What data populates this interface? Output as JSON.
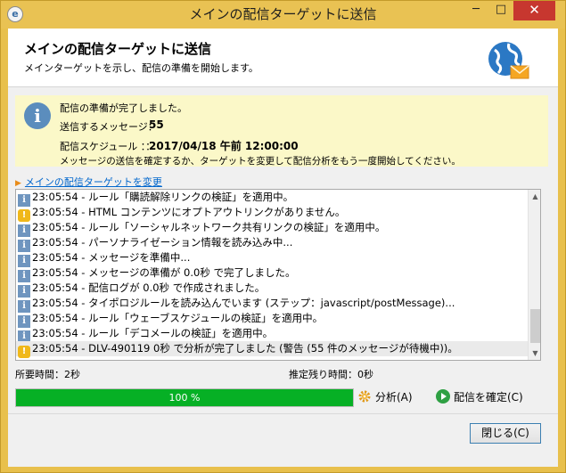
{
  "window": {
    "title": "メインの配信ターゲットに送信",
    "close_glyph": "✕",
    "minimize_glyph": "─",
    "maximize_glyph": "□"
  },
  "header": {
    "title": "メインの配信ターゲットに送信",
    "subtitle": "メインターゲットを示し、配信の準備を開始します。"
  },
  "info": {
    "status": "配信の準備が完了しました。",
    "messages_label": "送信するメッセージ：",
    "messages_value": "55",
    "schedule_label": "配信スケジュール ：：",
    "schedule_value": "2017/04/18 午前 12:00:00",
    "note": "メッセージの送信を確定するか、ターゲットを変更して配信分析をもう一度開始してください。"
  },
  "change_target_link": "メインの配信ターゲットを変更",
  "log": [
    {
      "type": "info",
      "text": "23:05:54 - ルール「購読解除リンクの検証」を適用中。"
    },
    {
      "type": "warn",
      "text": "23:05:54 - HTML コンテンツにオプトアウトリンクがありません。"
    },
    {
      "type": "info",
      "text": "23:05:54 - ルール「ソーシャルネットワーク共有リンクの検証」を適用中。"
    },
    {
      "type": "info",
      "text": "23:05:54 - パーソナライゼーション情報を読み込み中..."
    },
    {
      "type": "info",
      "text": "23:05:54 - メッセージを準備中..."
    },
    {
      "type": "info",
      "text": "23:05:54 - メッセージの準備が 0.0秒 で完了しました。"
    },
    {
      "type": "info",
      "text": "23:05:54 - 配信ログが  0.0秒 で作成されました。"
    },
    {
      "type": "info",
      "text": "23:05:54 - タイポロジルールを読み込んでいます (ステップ：javascript/postMessage)..."
    },
    {
      "type": "info",
      "text": "23:05:54 - ルール「ウェーブスケジュールの検証」を適用中。"
    },
    {
      "type": "info",
      "text": "23:05:54 - ルール「デコメールの検証」を適用中。"
    },
    {
      "type": "warn",
      "text": "23:05:54 - DLV-490119 0秒 で分析が完了しました (警告 (55 件のメッセージが待機中))。"
    }
  ],
  "selected_log_index": 10,
  "elapsed": "所要時間：2秒",
  "remaining": "推定残り時間：0秒",
  "progress": {
    "percent": 100,
    "label": "100 %",
    "color": "#06b025"
  },
  "buttons": {
    "analyze": "分析(A)",
    "confirm": "配信を確定(C)",
    "close": "閉じる(C)"
  },
  "colors": {
    "frame": "#e9c253",
    "info_panel": "#fbf8c8",
    "link": "#0066cc"
  }
}
